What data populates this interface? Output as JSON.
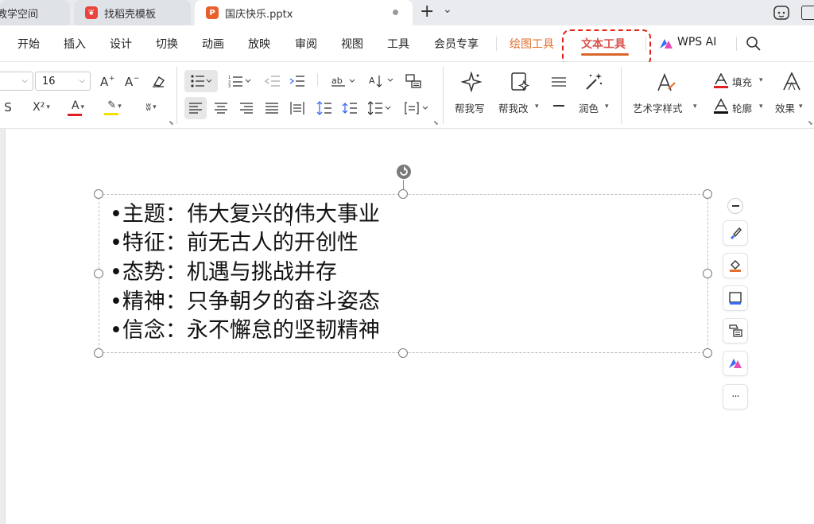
{
  "tabs": [
    {
      "label": "教学空间"
    },
    {
      "label": "找稻壳模板"
    },
    {
      "label": "国庆快乐.pptx"
    }
  ],
  "tab_add": "+",
  "tab_more": "⌄",
  "menu": {
    "items": [
      "开始",
      "插入",
      "设计",
      "切换",
      "动画",
      "放映",
      "审阅",
      "视图",
      "工具",
      "会员专享"
    ],
    "draw_tools": "绘图工具",
    "text_tools": "文本工具",
    "wps_ai": "WPS AI"
  },
  "ribbon": {
    "font_size": "16",
    "help_write": "帮我写",
    "help_edit": "帮我改",
    "polish": "润色",
    "art_style": "艺术字样式",
    "fill": "填充",
    "outline": "轮廓",
    "effect": "效果"
  },
  "colors": {
    "accent": "#d9662a",
    "highlight_box": "#e1251b",
    "font_red": "#e02020",
    "highlight_yellow": "#f5e000"
  },
  "slide": {
    "lines": [
      "•主题：伟大复兴的伟大事业",
      "•特征：前无古人的开创性",
      "•态势：机遇与挑战并存",
      "•精神：只争朝夕的奋斗姿态",
      "•信念：永不懈怠的坚韧精神"
    ]
  },
  "side_tools": [
    "minus-icon",
    "brush-icon",
    "fill-bucket-icon",
    "frame-icon",
    "shape-edit-icon",
    "wps-ai-icon",
    "more-icon"
  ],
  "side_more": "···"
}
